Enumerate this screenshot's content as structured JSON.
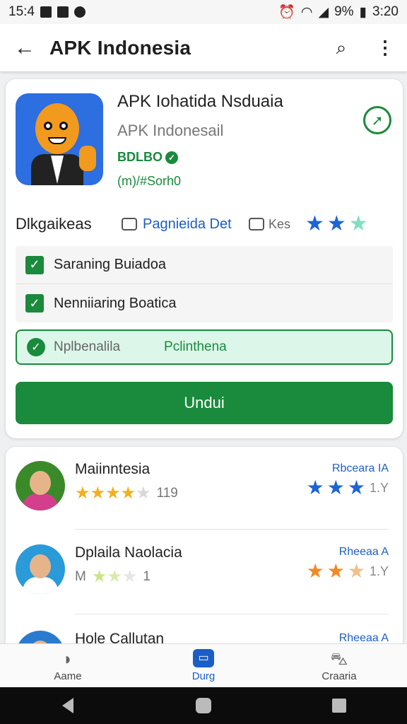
{
  "status": {
    "left": "15:4",
    "time": "3:20",
    "battery": "9%"
  },
  "appbar": {
    "title": "APK Indonesia",
    "back": "←",
    "search": "⌕",
    "more": "⋮"
  },
  "app": {
    "title": "APK Iohatida Nsduaia",
    "subtitle": "APK Indonesail",
    "verified": "BDLBO",
    "meta": "(m)/#Sorh0",
    "open_icon": "➚"
  },
  "info": {
    "label": "Dlkgaikeas",
    "link": "Pagnieida Det",
    "keys": "Kes"
  },
  "options": [
    {
      "label": "Saraning Buiadoa"
    },
    {
      "label": "Nenniiaring Boatica"
    }
  ],
  "selected": {
    "label": "Nplbenalila",
    "value": "Pclinthena"
  },
  "download": {
    "label": "Undui"
  },
  "list": [
    {
      "name": "Maiinntesia",
      "stars": "★★★★★",
      "count": "119",
      "right_label": "Rbceara IA",
      "right_stars": "★★★",
      "right_count": "1.Y"
    },
    {
      "name": "Dplaila Naolacia",
      "stars": "★★★",
      "count": "1",
      "prefix": "M",
      "right_label": "Rheeaa A",
      "right_stars": "★★★",
      "right_count": "1.Y"
    },
    {
      "name": "Hole Callutan",
      "right_label": "Rheeaa A"
    }
  ],
  "nav": [
    {
      "label": "Aame",
      "icon": "◗"
    },
    {
      "label": "Durg",
      "icon": "▭"
    },
    {
      "label": "Craaria",
      "icon": "⛍"
    }
  ],
  "colors": {
    "green": "#1a8a3c",
    "blue": "#1b5fc6",
    "star_blue": "#1b66d6",
    "star_orange": "#f08a24",
    "star_gold": "#f2b01e"
  }
}
